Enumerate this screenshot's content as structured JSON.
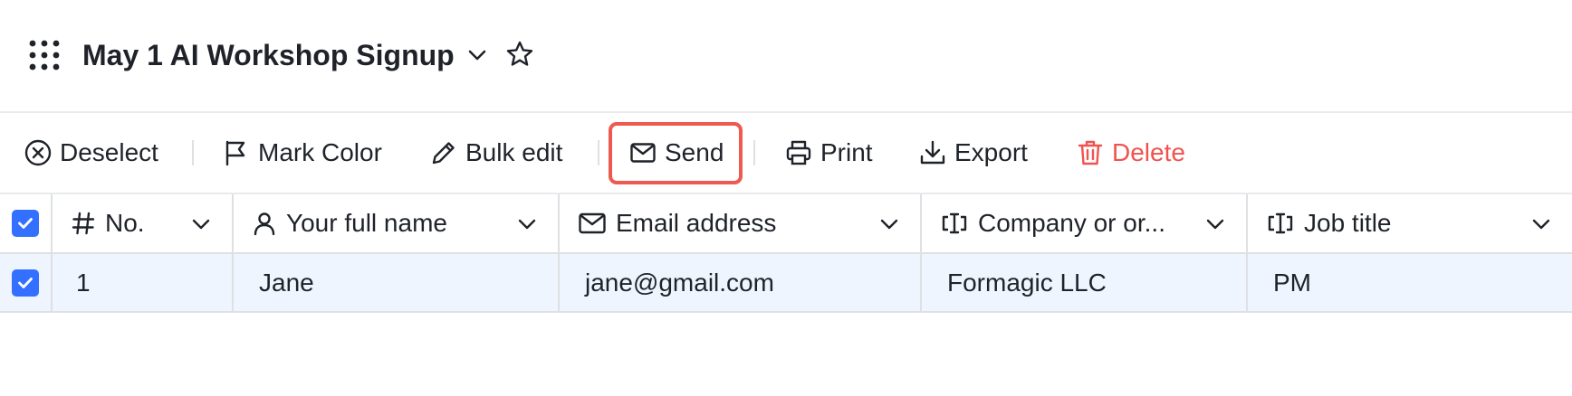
{
  "header": {
    "title": "May 1 AI Workshop Signup"
  },
  "toolbar": {
    "deselect_label": "Deselect",
    "mark_color_label": "Mark Color",
    "bulk_edit_label": "Bulk edit",
    "send_label": "Send",
    "print_label": "Print",
    "export_label": "Export",
    "delete_label": "Delete"
  },
  "table": {
    "columns": [
      {
        "label": "No.",
        "icon": "hash-icon"
      },
      {
        "label": "Your full name",
        "icon": "person-icon"
      },
      {
        "label": "Email address",
        "icon": "mail-icon"
      },
      {
        "label": "Company or or...",
        "icon": "text-field-icon"
      },
      {
        "label": "Job title",
        "icon": "text-field-icon"
      }
    ],
    "rows": [
      {
        "no": "1",
        "name": "Jane",
        "email": "jane@gmail.com",
        "company": "Formagic LLC",
        "job_title": "PM",
        "selected": true
      }
    ],
    "all_selected": true
  },
  "colors": {
    "accent": "#3370ff",
    "danger": "#f0524f",
    "highlight": "#ee5a4f",
    "selected_row": "#eef5fe"
  }
}
